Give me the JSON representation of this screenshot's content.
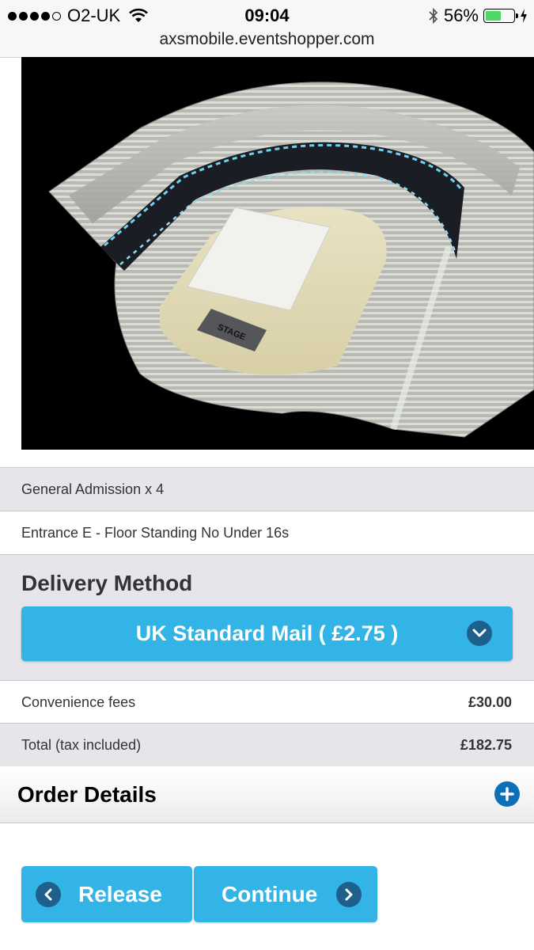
{
  "status_bar": {
    "carrier": "O2-UK",
    "time": "09:04",
    "battery_percent": "56%",
    "battery_level": 0.56
  },
  "browser": {
    "url": "axsmobile.eventshopper.com"
  },
  "venue_map": {
    "stage_label": "STAGE"
  },
  "ticket": {
    "type": "General Admission x 4",
    "entrance": "Entrance E - Floor Standing No Under 16s"
  },
  "delivery": {
    "title": "Delivery Method",
    "selected": "UK Standard Mail ( £2.75 )"
  },
  "fees": {
    "convenience_label": "Convenience fees",
    "convenience_amount": "£30.00",
    "total_label": "Total (tax included)",
    "total_amount": "£182.75"
  },
  "order_details": {
    "title": "Order Details"
  },
  "actions": {
    "release_label": "Release",
    "continue_label": "Continue"
  },
  "colors": {
    "accent": "#32b4e6",
    "icon_dark": "#1f5f8c",
    "plus_blue": "#0d6fb8",
    "row_grey": "#e6e6ea"
  }
}
